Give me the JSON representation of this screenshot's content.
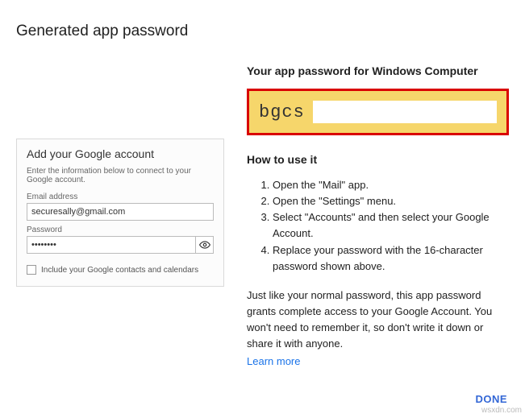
{
  "title": "Generated app password",
  "right": {
    "heading": "Your app password for Windows Computer",
    "password_visible": "bgcs",
    "howto_title": "How to use it",
    "steps": [
      "Open the \"Mail\" app.",
      "Open the \"Settings\" menu.",
      "Select \"Accounts\" and then select your Google Account.",
      "Replace your password with the 16-character password shown above."
    ],
    "note": "Just like your normal password, this app password grants complete access to your Google Account. You won't need to remember it, so don't write it down or share it with anyone.",
    "learn_more": "Learn more"
  },
  "left_dialog": {
    "title": "Add your Google account",
    "subtitle": "Enter the information below to connect to your Google account.",
    "email_label": "Email address",
    "email_value": "securesally@gmail.com",
    "password_label": "Password",
    "password_value": "••••••••",
    "checkbox_label": "Include your Google contacts and calendars"
  },
  "footer": {
    "done": "DONE"
  },
  "watermark": "wsxdn.com"
}
